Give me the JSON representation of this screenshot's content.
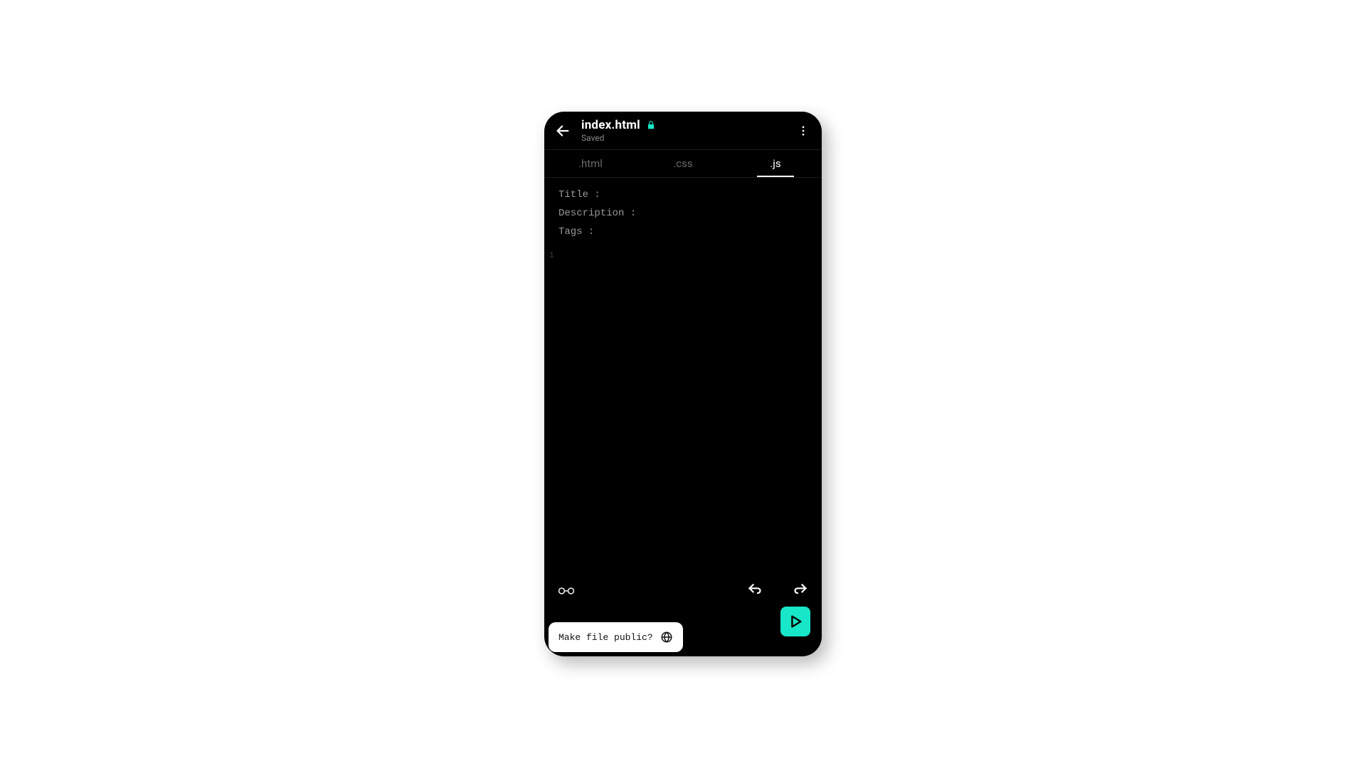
{
  "header": {
    "title": "index.html",
    "status": "Saved"
  },
  "tabs": [
    {
      "label": ".html",
      "active": false
    },
    {
      "label": ".css",
      "active": false
    },
    {
      "label": ".js",
      "active": true
    }
  ],
  "meta": {
    "title_label": "Title :",
    "description_label": "Description :",
    "tags_label": "Tags :"
  },
  "editor": {
    "line_number": "1"
  },
  "prompt": {
    "text": "Make file public?"
  },
  "colors": {
    "accent": "#18e6c8",
    "bg": "#000000"
  }
}
